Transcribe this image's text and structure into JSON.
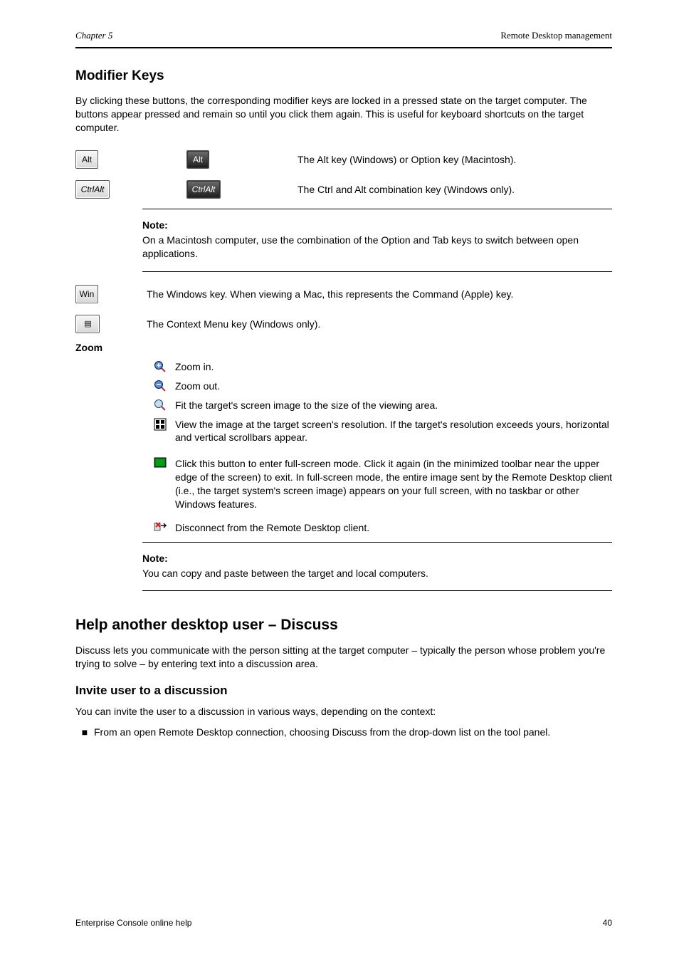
{
  "header": {
    "chapter_ref": "Chapter 5",
    "chapter_title": "Remote Desktop management"
  },
  "section_modifier_keys": {
    "title": "Modifier Keys",
    "intro": "By clicking these buttons, the corresponding modifier keys are locked in a pressed state on the target computer. The buttons appear pressed and remain so until you click them again. This is useful for keyboard shortcuts on the target computer.",
    "rows": [
      {
        "key_label": "Alt",
        "selected_key_label": "Alt",
        "desc": "The Alt key (Windows) or Option key (Macintosh)."
      },
      {
        "key_label": "CtrlAlt",
        "selected_key_label": "CtrlAlt",
        "desc": "The Ctrl and Alt combination key (Windows only)."
      }
    ],
    "note": {
      "label": "Note:",
      "text": "On a Macintosh computer, use the combination of the Option and Tab keys to switch between open applications."
    },
    "win_key_label": "Win",
    "win_desc": "The Windows key. When viewing a Mac, this represents the Command (Apple) key.",
    "menu_key_glyph": "▤",
    "menu_desc": "The Context Menu key (Windows only).",
    "zoom_title": "Zoom",
    "zoom_items": [
      {
        "icon": "zoom-in",
        "desc": "Zoom in."
      },
      {
        "icon": "zoom-out",
        "desc": "Zoom out."
      },
      {
        "icon": "zoom-fit",
        "desc": "Fit the target's screen image to the size of the viewing area."
      },
      {
        "icon": "zoom-100",
        "desc": "View the image at the target screen's resolution. If the target's resolution exceeds yours, horizontal and vertical scrollbars appear."
      }
    ],
    "full_desc": "Click this button to enter full-screen mode. Click it again (in the minimized toolbar near the upper edge of the screen) to exit. In full-screen mode, the entire image sent by the Remote Desktop client (i.e., the target system's screen image) appears on your full screen, with no taskbar or other Windows features.",
    "disconnect_desc": "Disconnect from the Remote Desktop client.",
    "clipboard_note": {
      "label": "Note:",
      "text": "You can copy and paste between the target and local computers."
    }
  },
  "section_discuss": {
    "title": "Help another desktop user – Discuss",
    "intro": "Discuss lets you communicate with the person sitting at the target computer – typically the person whose problem you're trying to solve – by entering text into a discussion area.",
    "invite_title": "Invite user to a discussion",
    "invite_steps_lead": "You can invite the user to a discussion in various ways, depending on the context:",
    "invite_bullets": [
      "From an open Remote Desktop connection, choosing Discuss from the drop-down list on the tool panel."
    ]
  },
  "footer": {
    "left": "Enterprise Console online help",
    "right": "40"
  }
}
